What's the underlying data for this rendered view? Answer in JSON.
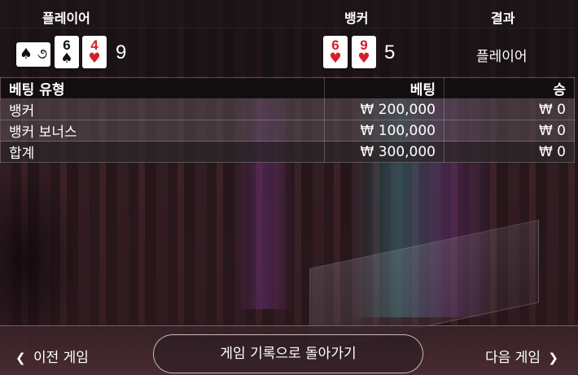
{
  "header": {
    "player_label": "플레이어",
    "banker_label": "뱅커",
    "result_label": "결과"
  },
  "hand": {
    "player_extra_card": "♠ ૭",
    "player_cards": [
      {
        "rank": "6",
        "suit": "♠",
        "color": "#111111"
      },
      {
        "rank": "4",
        "suit": "♥",
        "color": "#d31f2c"
      }
    ],
    "player_score": "9",
    "banker_cards": [
      {
        "rank": "6",
        "suit": "♥",
        "color": "#d31f2c"
      },
      {
        "rank": "9",
        "suit": "♥",
        "color": "#d31f2c"
      }
    ],
    "banker_score": "5",
    "result": "플레이어"
  },
  "bets": {
    "columns": [
      "베팅 유형",
      "베팅",
      "승"
    ],
    "rows": [
      {
        "type": "뱅커",
        "bet": "₩ 200,000",
        "win": "₩ 0"
      },
      {
        "type": "뱅커 보너스",
        "bet": "₩ 100,000",
        "win": "₩ 0"
      },
      {
        "type": "합계",
        "bet": "₩ 300,000",
        "win": "₩ 0"
      }
    ]
  },
  "footer": {
    "prev_label": "이전 게임",
    "history_label": "게임 기록으로 돌아가기",
    "next_label": "다음 게임"
  }
}
